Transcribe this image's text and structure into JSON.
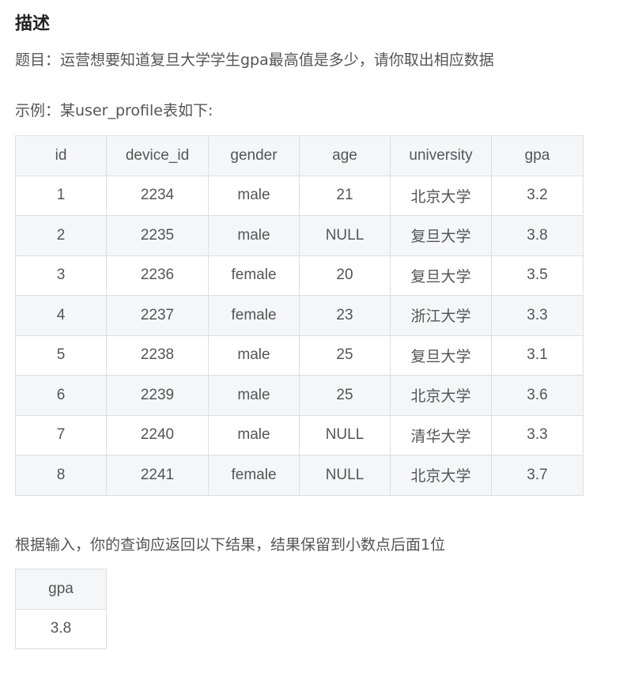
{
  "heading": "描述",
  "question": "题目：运营想要知道复旦大学学生gpa最高值是多少，请你取出相应数据",
  "example_intro": "示例：某user_profile表如下:",
  "profile_table": {
    "columns": [
      "id",
      "device_id",
      "gender",
      "age",
      "university",
      "gpa"
    ],
    "rows": [
      [
        "1",
        "2234",
        "male",
        "21",
        "北京大学",
        "3.2"
      ],
      [
        "2",
        "2235",
        "male",
        "NULL",
        "复旦大学",
        "3.8"
      ],
      [
        "3",
        "2236",
        "female",
        "20",
        "复旦大学",
        "3.5"
      ],
      [
        "4",
        "2237",
        "female",
        "23",
        "浙江大学",
        "3.3"
      ],
      [
        "5",
        "2238",
        "male",
        "25",
        "复旦大学",
        "3.1"
      ],
      [
        "6",
        "2239",
        "male",
        "25",
        "北京大学",
        "3.6"
      ],
      [
        "7",
        "2240",
        "male",
        "NULL",
        "清华大学",
        "3.3"
      ],
      [
        "8",
        "2241",
        "female",
        "NULL",
        "北京大学",
        "3.7"
      ]
    ]
  },
  "result_intro": "根据输入，你的查询应返回以下结果，结果保留到小数点后面1位",
  "result_table": {
    "columns": [
      "gpa"
    ],
    "rows": [
      [
        "3.8"
      ]
    ]
  }
}
